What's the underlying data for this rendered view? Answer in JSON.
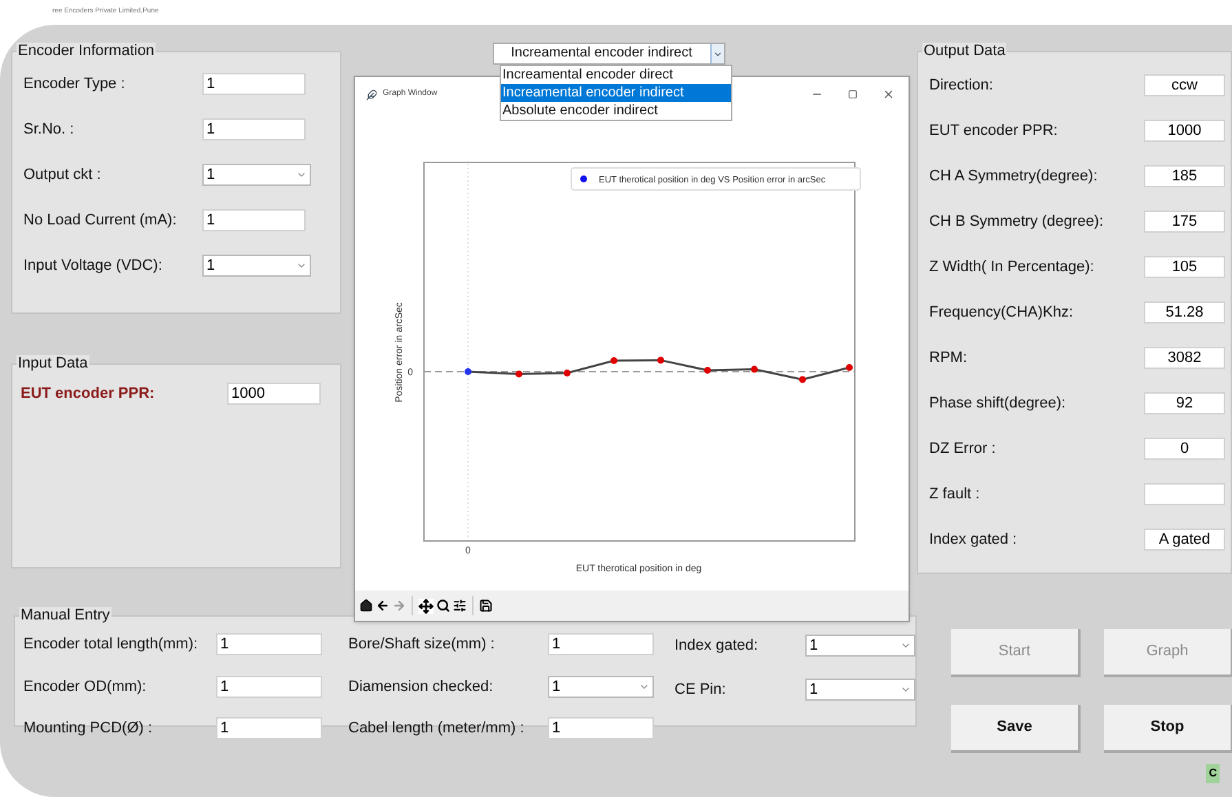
{
  "window": {
    "title": "ree Encoders Private Limited,Pune"
  },
  "encoder_information": {
    "title": "Encoder Information",
    "fields": [
      {
        "label": "Encoder Type :",
        "value": "1",
        "kind": "text"
      },
      {
        "label": "Sr.No. :",
        "value": "1",
        "kind": "text"
      },
      {
        "label": "Output ckt :",
        "value": "1",
        "kind": "select"
      },
      {
        "label": "No Load Current (mA):",
        "value": "1",
        "kind": "text"
      },
      {
        "label": "Input Voltage (VDC):",
        "value": "1",
        "kind": "select"
      }
    ]
  },
  "input_data": {
    "title": "Input Data",
    "fields": [
      {
        "label": "EUT encoder PPR:",
        "value": "1000"
      }
    ]
  },
  "encoder_mode": {
    "value": "Increamental encoder indirect",
    "options": [
      {
        "label": "Increamental encoder direct",
        "selected": false
      },
      {
        "label": "Increamental encoder indirect",
        "selected": true
      },
      {
        "label": "Absolute encoder indirect",
        "selected": false
      }
    ]
  },
  "graph_window": {
    "title": "Graph Window",
    "legend": "EUT therotical position in deg VS Position error in arcSec",
    "ylabel": "Position error in arcSec",
    "xlabel": "EUT therotical position in deg",
    "xtick": "0",
    "ytick": "0"
  },
  "output_data": {
    "title": "Output Data",
    "fields": [
      {
        "label": "Direction:",
        "value": "ccw"
      },
      {
        "label": "EUT encoder PPR:",
        "value": "1000"
      },
      {
        "label": "CH A Symmetry(degree):",
        "value": "185"
      },
      {
        "label": "CH B Symmetry (degree):",
        "value": "175"
      },
      {
        "label": "Z Width( In Percentage):",
        "value": "105"
      },
      {
        "label": "Frequency(CHA)Khz:",
        "value": "51.28"
      },
      {
        "label": "RPM:",
        "value": "3082"
      },
      {
        "label": "Phase shift(degree):",
        "value": "92"
      },
      {
        "label": "DZ Error :",
        "value": "0"
      },
      {
        "label": "Z fault :"
      },
      {
        "label": "Index gated :",
        "value": "A gated"
      }
    ]
  },
  "manual_entry": {
    "title": "Manual Entry",
    "columns": [
      {
        "fields": [
          {
            "label": "Encoder total length(mm):",
            "value": "1",
            "kind": "text"
          },
          {
            "label": "Encoder OD(mm):",
            "value": "1",
            "kind": "text"
          },
          {
            "label": "Mounting PCD(Ø) :",
            "value": "1",
            "kind": "text"
          }
        ]
      },
      {
        "fields": [
          {
            "label": "Bore/Shaft size(mm) :",
            "value": "1",
            "kind": "text"
          },
          {
            "label": "Diamension checked:",
            "value": "1",
            "kind": "select"
          },
          {
            "label": "Cabel length (meter/mm) :",
            "value": "1",
            "kind": "text"
          }
        ]
      },
      {
        "fields": [
          {
            "label": "Index gated:",
            "value": "1",
            "kind": "select"
          },
          {
            "label": "CE Pin:",
            "value": "1",
            "kind": "select"
          }
        ]
      }
    ]
  },
  "buttons": [
    {
      "label": "Start",
      "disabled": true
    },
    {
      "label": "Graph",
      "disabled": true
    },
    {
      "label": "Save",
      "disabled": false
    },
    {
      "label": "Stop",
      "disabled": false
    }
  ],
  "status_badge": "C"
}
